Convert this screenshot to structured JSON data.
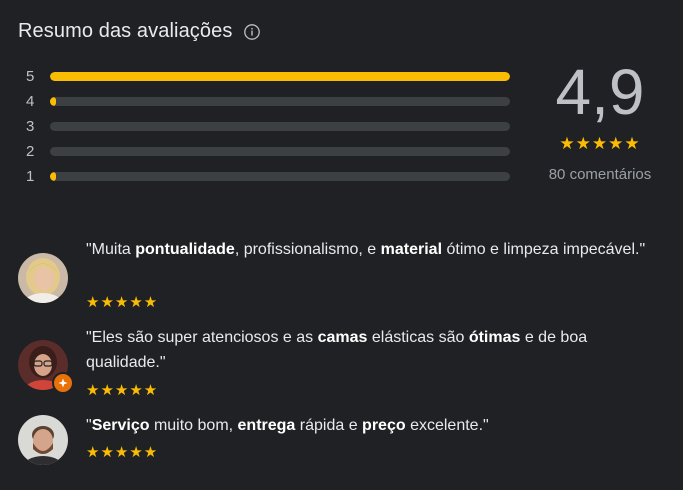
{
  "header": {
    "title": "Resumo das avaliações",
    "info_icon": "info-icon"
  },
  "colors": {
    "accent": "#fbbc04",
    "track": "#3c4043",
    "background": "#202124"
  },
  "rating_bars": [
    {
      "stars": "5",
      "fraction": 1.0
    },
    {
      "stars": "4",
      "fraction": 0.012
    },
    {
      "stars": "3",
      "fraction": 0.0
    },
    {
      "stars": "2",
      "fraction": 0.0
    },
    {
      "stars": "1",
      "fraction": 0.012
    }
  ],
  "summary": {
    "score": "4,9",
    "stars": "★★★★★",
    "count": "80 comentários"
  },
  "reviews": [
    {
      "parts": [
        {
          "t": "\"Muita ",
          "b": false
        },
        {
          "t": "pontualidade",
          "b": true
        },
        {
          "t": ", profissionalismo, e ",
          "b": false
        },
        {
          "t": "material",
          "b": true
        },
        {
          "t": " ótimo e limpeza impecável.\"",
          "b": false
        }
      ],
      "stars": "★★★★★",
      "avatar": "avatar-woman-blonde"
    },
    {
      "parts": [
        {
          "t": "\"Eles são super atenciosos e as ",
          "b": false
        },
        {
          "t": "camas",
          "b": true
        },
        {
          "t": " elásticas são ",
          "b": false
        },
        {
          "t": "ótimas",
          "b": true
        },
        {
          "t": " e de boa qualidade.\"",
          "b": false
        }
      ],
      "stars": "★★★★★",
      "avatar": "avatar-woman-glasses"
    },
    {
      "parts": [
        {
          "t": "\"",
          "b": false
        },
        {
          "t": "Serviço",
          "b": true
        },
        {
          "t": " muito bom, ",
          "b": false
        },
        {
          "t": "entrega",
          "b": true
        },
        {
          "t": " rápida e ",
          "b": false
        },
        {
          "t": "preço",
          "b": true
        },
        {
          "t": " excelente.\"",
          "b": false
        }
      ],
      "stars": "★★★★★",
      "avatar": "avatar-man-beard"
    }
  ]
}
